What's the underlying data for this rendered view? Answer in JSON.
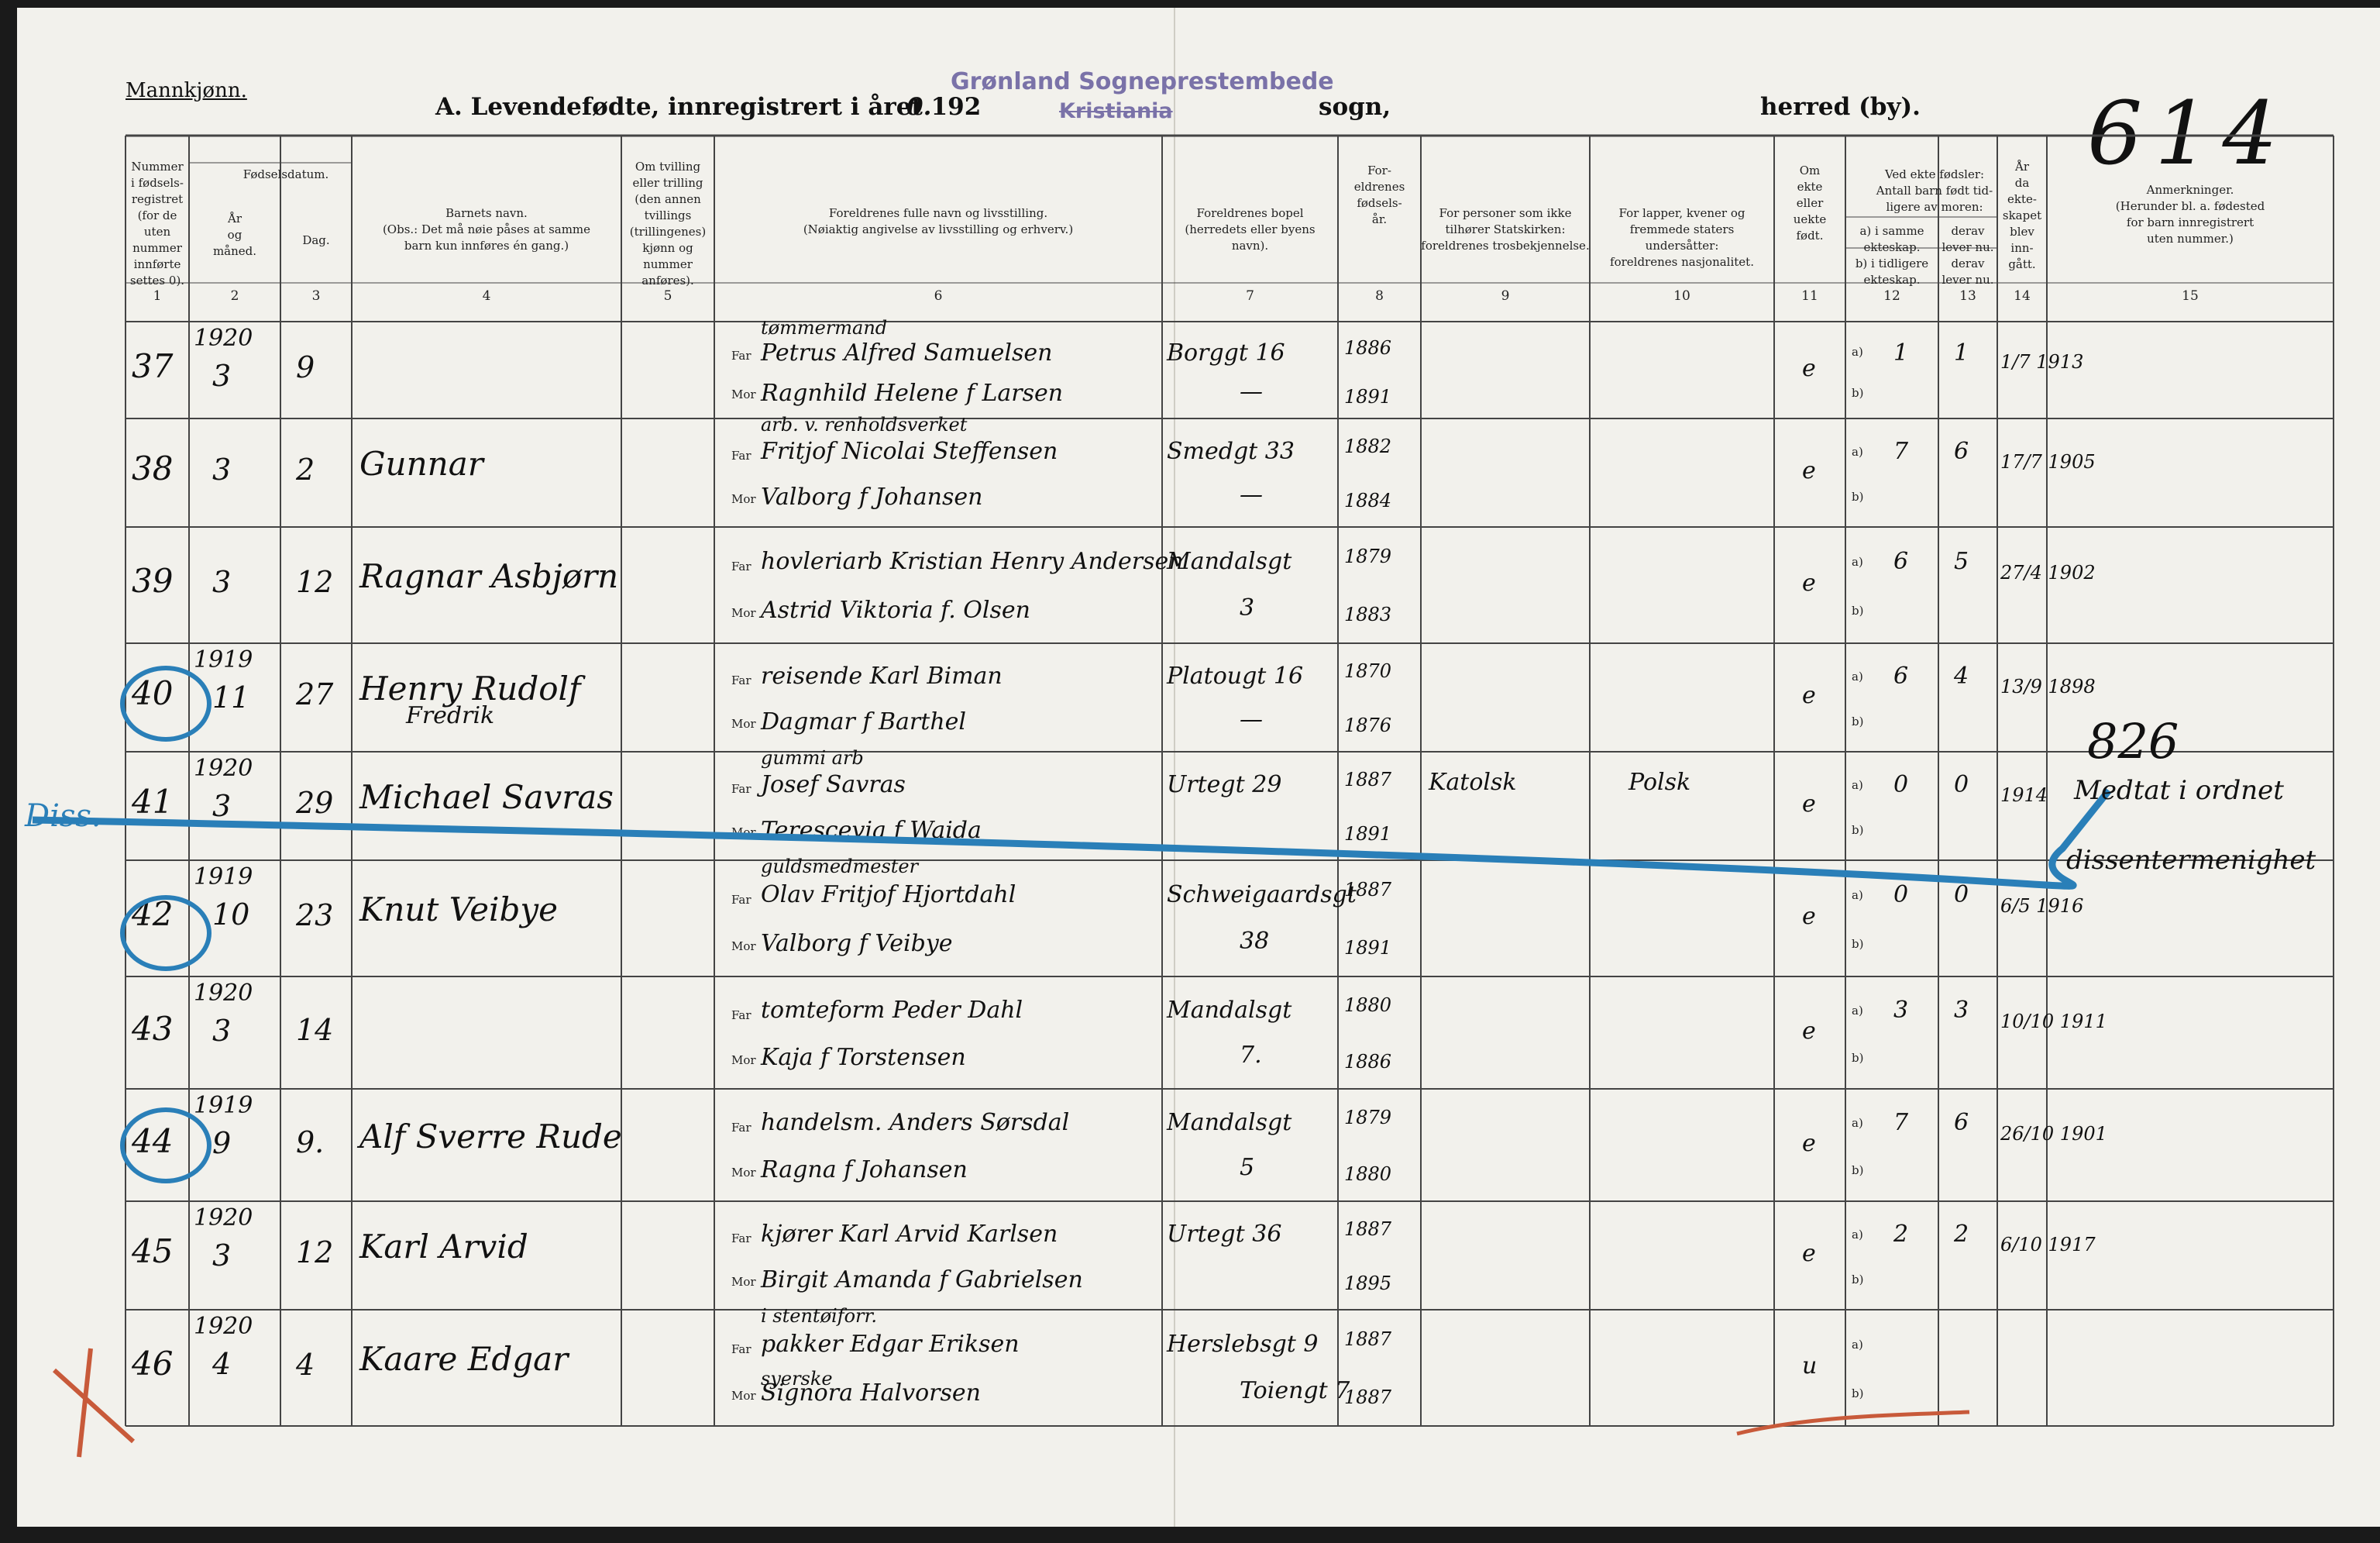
{
  "header": {
    "gender": "Mannkjønn.",
    "title": "A.  Levendefødte, innregistrert i året 192",
    "year_suffix": "0.",
    "stamp_line1": "Grønland Sogneprestembede",
    "stamp_line2": "Kristiania",
    "sogn": "sogn,",
    "herred": "herred (by).",
    "page_number": "614"
  },
  "columns": [
    {
      "num": "1",
      "head": "Nummer\ni fødsels-\nregistret\n(for de\nuten\nnummer\ninnførte\nsettes 0)."
    },
    {
      "num": "2",
      "head": "År\nog\nmåned."
    },
    {
      "num": "3",
      "head": "Dag."
    },
    {
      "num": "4",
      "head": "Barnets navn.\n(Obs.: Det må nøie påses at samme\nbarn kun innføres én gang.)"
    },
    {
      "num": "5",
      "head": "Om tvilling\neller trilling\n(den annen\ntvillings\n(trillingenes)\nkjønn og\nnummer\nanføres)."
    },
    {
      "num": "6",
      "head": "Foreldrenes fulle navn og livsstilling.\n(Nøiaktig angivelse av livsstilling og erhverv.)"
    },
    {
      "num": "7",
      "head": "Foreldrenes bopel\n(herredets eller byens\nnavn)."
    },
    {
      "num": "8",
      "head": "For-\neldrenes\nfødsels-\når."
    },
    {
      "num": "9",
      "head": "For personer som ikke\ntilhører Statskirken:\nforeldrenes trosbekjennelse."
    },
    {
      "num": "10",
      "head": "For lapper, kvener og\nfremmede staters\nundersåtter:\nforeldrenes nasjonalitet."
    },
    {
      "num": "11",
      "head": "Om\nekte\neller\nuekte\nfødt."
    },
    {
      "num": "12",
      "head": "a) i samme\nekteskap.\nb) i tidligere\nekteskap."
    },
    {
      "num": "13",
      "head": "derav\nlever nu.\nderav\nlever nu."
    },
    {
      "num": "14",
      "head": "År\nda\nekte-\nskapet\nblev\ninn-\ngått."
    },
    {
      "num": "15",
      "head": "Anmerkninger.\n(Herunder bl. a. fødested\nfor barn innregistrert\nuten nummer.)"
    }
  ],
  "fodselsdatum_label": "Fødselsdatum.",
  "ekte_header": "Ved ekte fødsler:\nAntall barn født tid-\nligere av moren:",
  "labels": {
    "far": "Far",
    "mor": "Mor",
    "a": "a)",
    "b": "b)"
  },
  "rows": [
    {
      "nr": "37",
      "year": "1920",
      "month": "3",
      "day": "9",
      "name": "",
      "name2": "",
      "far_occ": "tømmermand",
      "far": "Petrus Alfred Samuelsen",
      "mor": "Ragnhild Helene f Larsen",
      "bopel": "Borggt 16",
      "bopel2": "—",
      "far_year": "1886",
      "mor_year": "1891",
      "tro": "",
      "nasj": "",
      "ekte": "e",
      "a12": "1",
      "a13": "1",
      "gift": "1/7 1913"
    },
    {
      "nr": "38",
      "year": "",
      "month": "3",
      "day": "2",
      "name": "Gunnar",
      "name2": "",
      "far_occ": "arb. v. renholdsverket",
      "far": "Fritjof Nicolai Steffensen",
      "mor": "Valborg f Johansen",
      "bopel": "Smedgt 33",
      "bopel2": "—",
      "far_year": "1882",
      "mor_year": "1884",
      "tro": "",
      "nasj": "",
      "ekte": "e",
      "a12": "7",
      "a13": "6",
      "gift": "17/7 1905"
    },
    {
      "nr": "39",
      "year": "",
      "month": "3",
      "day": "12",
      "name": "Ragnar Asbjørn",
      "name2": "",
      "far_occ": "",
      "far": "hovleriarb Kristian Henry Andersen",
      "mor": "Astrid Viktoria f. Olsen",
      "bopel": "Mandalsgt",
      "bopel2": "3",
      "far_year": "1879",
      "mor_year": "1883",
      "tro": "",
      "nasj": "",
      "ekte": "e",
      "a12": "6",
      "a13": "5",
      "gift": "27/4 1902"
    },
    {
      "nr": "40",
      "year": "1919",
      "month": "11",
      "day": "27",
      "name": "Henry Rudolf",
      "name2": "Fredrik",
      "far_occ": "",
      "far": "reisende Karl Biman",
      "mor": "Dagmar f Barthel",
      "bopel": "Platougt 16",
      "bopel2": "—",
      "far_year": "1870",
      "mor_year": "1876",
      "tro": "",
      "nasj": "",
      "ekte": "e",
      "a12": "6",
      "a13": "4",
      "gift": "13/9 1898"
    },
    {
      "nr": "41",
      "year": "1920",
      "month": "3",
      "day": "29",
      "name": "Michael Savras",
      "name2": "",
      "far_occ": "gummi arb",
      "far": "Josef Savras",
      "mor": "Terescevia f Waida",
      "bopel": "Urtegt 29",
      "bopel2": "",
      "far_year": "1887",
      "mor_year": "1891",
      "tro": "Katolsk",
      "nasj": "Polsk",
      "ekte": "e",
      "a12": "0",
      "a13": "0",
      "gift": "1914"
    },
    {
      "nr": "42",
      "year": "1919",
      "month": "10",
      "day": "23",
      "name": "Knut Veibye",
      "name2": "",
      "far_occ": "guldsmedmester",
      "far": "Olav Fritjof Hjortdahl",
      "mor": "Valborg f Veibye",
      "bopel": "Schweigaardsgt",
      "bopel2": "38",
      "far_year": "1887",
      "mor_year": "1891",
      "tro": "",
      "nasj": "",
      "ekte": "e",
      "a12": "0",
      "a13": "0",
      "gift": "6/5 1916"
    },
    {
      "nr": "43",
      "year": "1920",
      "month": "3",
      "day": "14",
      "name": "",
      "name2": "",
      "far_occ": "",
      "far": "tomteform Peder Dahl",
      "mor": "Kaja f Torstensen",
      "bopel": "Mandalsgt",
      "bopel2": "7.",
      "far_year": "1880",
      "mor_year": "1886",
      "tro": "",
      "nasj": "",
      "ekte": "e",
      "a12": "3",
      "a13": "3",
      "gift": "10/10 1911"
    },
    {
      "nr": "44",
      "year": "1919",
      "month": "9",
      "day": "9.",
      "name": "Alf Sverre Rude",
      "name2": "",
      "far_occ": "",
      "far": "handelsm. Anders Sørsdal",
      "mor": "Ragna f Johansen",
      "bopel": "Mandalsgt",
      "bopel2": "5",
      "far_year": "1879",
      "mor_year": "1880",
      "tro": "",
      "nasj": "",
      "ekte": "e",
      "a12": "7",
      "a13": "6",
      "gift": "26/10 1901"
    },
    {
      "nr": "45",
      "year": "1920",
      "month": "3",
      "day": "12",
      "name": "Karl Arvid",
      "name2": "",
      "far_occ": "",
      "far": "kjører Karl Arvid Karlsen",
      "mor": "Birgit Amanda f Gabrielsen",
      "bopel": "Urtegt 36",
      "bopel2": "",
      "far_year": "1887",
      "mor_year": "1895",
      "tro": "",
      "nasj": "",
      "ekte": "e",
      "a12": "2",
      "a13": "2",
      "gift": "6/10 1917"
    },
    {
      "nr": "46",
      "year": "1920",
      "month": "4",
      "day": "4",
      "name": "Kaare Edgar",
      "name2": "",
      "far_occ": "i stentøiforr.",
      "far": "pakker Edgar Eriksen",
      "mor": "Signora Halvorsen",
      "mor_occ": "syerske",
      "bopel": "Herslebsgt 9",
      "bopel2": "Toiengt 7",
      "far_year": "1887",
      "mor_year": "1887",
      "tro": "",
      "nasj": "",
      "ekte": "u",
      "a12": "",
      "a13": "",
      "gift": ""
    }
  ],
  "annotations": {
    "diss_label": "Diss.",
    "far_right_826": "826",
    "remark_41_line1": "Medtat i ordnet",
    "remark_41_line2": "dissentermenighet"
  },
  "colors": {
    "paper": "#f2f1ec",
    "ink": "#111111",
    "blue_pencil": "#2a7fb8",
    "red_pencil": "#c85a3a",
    "stamp": "#7a72a8"
  }
}
